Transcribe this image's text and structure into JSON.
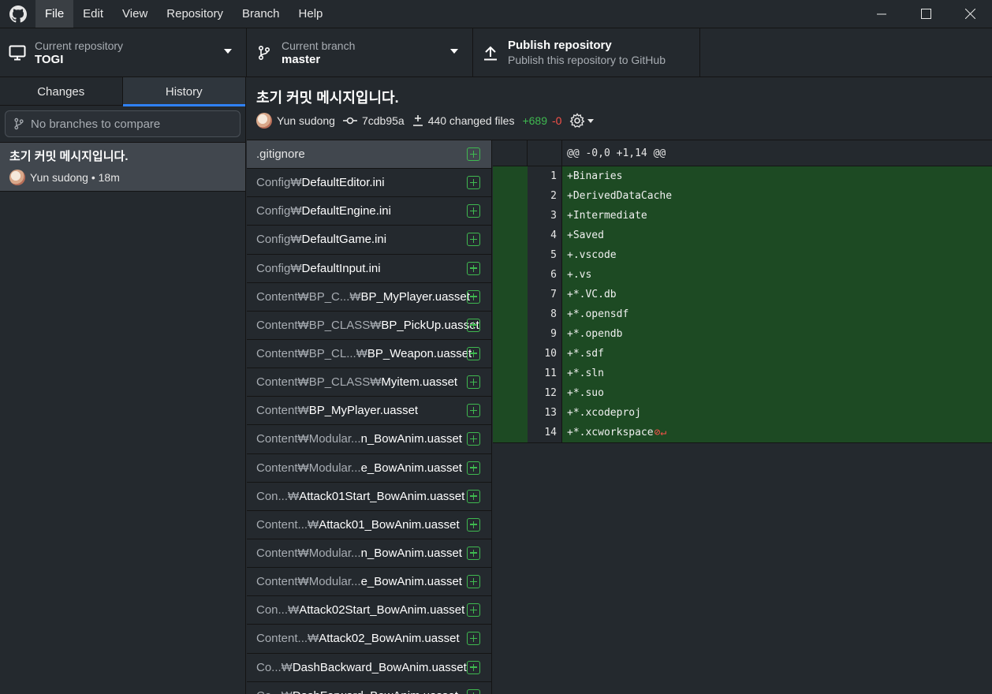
{
  "menu": {
    "items": [
      "File",
      "Edit",
      "View",
      "Repository",
      "Branch",
      "Help"
    ],
    "active_index": 0
  },
  "toolbar": {
    "repo_label": "Current repository",
    "repo_name": "TOGI",
    "branch_label": "Current branch",
    "branch_name": "master",
    "publish_title": "Publish repository",
    "publish_sub": "Publish this repository to GitHub"
  },
  "sidebar": {
    "tabs": [
      "Changes",
      "History"
    ],
    "active_tab": "History",
    "compare_placeholder": "No branches to compare",
    "commit": {
      "title": "초기 커밋 메시지입니다.",
      "author_time": "Yun sudong • 18m"
    }
  },
  "commit": {
    "title": "초기 커밋 메시지입니다.",
    "author": "Yun sudong",
    "sha": "7cdb95a",
    "changed_files": "440 changed files",
    "additions": "+689",
    "deletions": "-0"
  },
  "files": [
    {
      "dir": "",
      "name": ".gitignore"
    },
    {
      "dir": "Config₩",
      "name": "DefaultEditor.ini"
    },
    {
      "dir": "Config₩",
      "name": "DefaultEngine.ini"
    },
    {
      "dir": "Config₩",
      "name": "DefaultGame.ini"
    },
    {
      "dir": "Config₩",
      "name": "DefaultInput.ini"
    },
    {
      "dir": "Content₩BP_C...₩",
      "name": "BP_MyPlayer.uasset"
    },
    {
      "dir": "Content₩BP_CLASS₩",
      "name": "BP_PickUp.uasset"
    },
    {
      "dir": "Content₩BP_CL...₩",
      "name": "BP_Weapon.uasset"
    },
    {
      "dir": "Content₩BP_CLASS₩",
      "name": "Myitem.uasset"
    },
    {
      "dir": "Content₩",
      "name": "BP_MyPlayer.uasset"
    },
    {
      "dir": "Content₩Modular...",
      "name": "n_BowAnim.uasset"
    },
    {
      "dir": "Content₩Modular...",
      "name": "e_BowAnim.uasset"
    },
    {
      "dir": "Con...₩",
      "name": "Attack01Start_BowAnim.uasset"
    },
    {
      "dir": "Content...₩",
      "name": "Attack01_BowAnim.uasset"
    },
    {
      "dir": "Content₩Modular...",
      "name": "n_BowAnim.uasset"
    },
    {
      "dir": "Content₩Modular...",
      "name": "e_BowAnim.uasset"
    },
    {
      "dir": "Con...₩",
      "name": "Attack02Start_BowAnim.uasset"
    },
    {
      "dir": "Content...₩",
      "name": "Attack02_BowAnim.uasset"
    },
    {
      "dir": "Co...₩",
      "name": "DashBackward_BowAnim.uasset"
    },
    {
      "dir": "Co...₩",
      "name": "DashForward_BowAnim.uasset"
    }
  ],
  "diff": {
    "hunk_header": "@@ -0,0 +1,14 @@",
    "lines": [
      {
        "n": "1",
        "text": "+Binaries"
      },
      {
        "n": "2",
        "text": "+DerivedDataCache"
      },
      {
        "n": "3",
        "text": "+Intermediate"
      },
      {
        "n": "4",
        "text": "+Saved"
      },
      {
        "n": "5",
        "text": "+.vscode"
      },
      {
        "n": "6",
        "text": "+.vs"
      },
      {
        "n": "7",
        "text": "+*.VC.db"
      },
      {
        "n": "8",
        "text": "+*.opensdf"
      },
      {
        "n": "9",
        "text": "+*.opendb"
      },
      {
        "n": "10",
        "text": "+*.sdf"
      },
      {
        "n": "11",
        "text": "+*.sln"
      },
      {
        "n": "12",
        "text": "+*.suo"
      },
      {
        "n": "13",
        "text": "+*.xcodeproj"
      },
      {
        "n": "14",
        "text": "+*.xcworkspace"
      }
    ],
    "no_newline_marker": "⊘↵"
  },
  "colors": {
    "accent": "#2f81f7",
    "added": "#3fb950",
    "removed": "#f85149",
    "diff_add_bg": "#1d4a23"
  }
}
